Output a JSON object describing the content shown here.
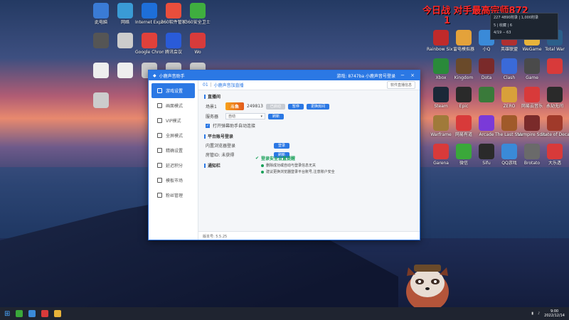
{
  "overlay": {
    "title": "今日战 对手最高宗师872",
    "number": "1"
  },
  "notification": {
    "line1": "227 4890附录 | 1,000附录",
    "line2": "5 | 收藏 | 6",
    "line3": "4/19 -- 63"
  },
  "desktop_left": [
    {
      "label": "此电脑",
      "color": "#3a7bd5"
    },
    {
      "label": "网络",
      "color": "#3a9bd5"
    },
    {
      "label": "Internet Explorer",
      "color": "#1e6fd9"
    },
    {
      "label": "360软件管家",
      "color": "#e94e3c"
    },
    {
      "label": "360安全卫士",
      "color": "#3fae3f"
    },
    {
      "label": "",
      "color": "#555"
    },
    {
      "label": "",
      "color": "#ccc"
    },
    {
      "label": "Google Chrome",
      "color": "#e0413b"
    },
    {
      "label": "腾讯会议",
      "color": "#2a5bd8"
    },
    {
      "label": "Wo",
      "color": "#d83b3b"
    },
    {
      "label": "",
      "color": "#eee"
    },
    {
      "label": "",
      "color": "#eee"
    },
    {
      "label": "",
      "color": "#ccc"
    },
    {
      "label": "",
      "color": "#ccc"
    },
    {
      "label": "",
      "color": "#ccc"
    },
    {
      "label": "",
      "color": "#ccc"
    }
  ],
  "desktop_right": [
    {
      "label": "Rainbow Six Siege",
      "color": "#c02a2a"
    },
    {
      "label": "雷电模拟器",
      "color": "#e4a23a"
    },
    {
      "label": "小Q",
      "color": "#3a8ad8"
    },
    {
      "label": "英雄联盟",
      "color": "#b03030"
    },
    {
      "label": "WeGame",
      "color": "#e8b33a"
    },
    {
      "label": "Total War",
      "color": "#2b5f8a"
    },
    {
      "label": "Xbox",
      "color": "#2a8a3a"
    },
    {
      "label": "Kingdom",
      "color": "#6a4a2a"
    },
    {
      "label": "Dota",
      "color": "#7a2a2a"
    },
    {
      "label": "Clash",
      "color": "#3a6ad8"
    },
    {
      "label": "Game",
      "color": "#4a4a4a"
    },
    {
      "label": "",
      "color": "#d83a3a"
    },
    {
      "label": "Steam",
      "color": "#1b2838"
    },
    {
      "label": "Epic",
      "color": "#2a2a2a"
    },
    {
      "label": "",
      "color": "#3a7a3a"
    },
    {
      "label": "ZERO",
      "color": "#d8a03a"
    },
    {
      "label": "网易云音乐",
      "color": "#d83a3a"
    },
    {
      "label": "永劫无间",
      "color": "#2a2a2a"
    },
    {
      "label": "Warframe",
      "color": "#a07a3a"
    },
    {
      "label": "网易有道",
      "color": "#d83a3a"
    },
    {
      "label": "Arcade",
      "color": "#7a3ad8"
    },
    {
      "label": "The Last Stand",
      "color": "#a05a2a"
    },
    {
      "label": "Vampire Survivors",
      "color": "#7a2a2a"
    },
    {
      "label": "State of Decay 2",
      "color": "#a03a2a"
    },
    {
      "label": "Garena",
      "color": "#d83a3a"
    },
    {
      "label": "微信",
      "color": "#3aa83a"
    },
    {
      "label": "Sifu",
      "color": "#2a2a2a"
    },
    {
      "label": "QQ游戏",
      "color": "#3a8ad8"
    },
    {
      "label": "Brotato",
      "color": "#6a6a6a"
    },
    {
      "label": "大乐透",
      "color": "#d83a3a"
    }
  ],
  "app": {
    "title": "小鹿声音助手",
    "right_title": "游戏: 8747ba 小鹿声音号登录",
    "sidebar": [
      {
        "label": "游戏设置",
        "active": true
      },
      {
        "label": "画面模式",
        "active": false
      },
      {
        "label": "VIP模式",
        "active": false
      },
      {
        "label": "全屏模式",
        "active": false
      },
      {
        "label": "精确设置",
        "active": false
      },
      {
        "label": "延迟积分",
        "active": false
      },
      {
        "label": "模板市场",
        "active": false
      },
      {
        "label": "粉丝管理",
        "active": false
      }
    ],
    "breadcrumb": {
      "home": "01",
      "current": "小鹿声音加直播",
      "right_button": "软件直播信息"
    },
    "live_section": "直播间",
    "room_label": "场景1",
    "room_number": "249813",
    "room_btn_disabled": "已启动",
    "room_btn1": "暂停",
    "room_btn2": "更换房间",
    "server_label": "服务器",
    "server_value": "自动",
    "refresh_btn": "刷新",
    "checkbox_label": "打开弹幕助手自动连接",
    "account_section": "平台账号登录",
    "account_row1_label": "内置浏览器登录",
    "account_row1_btn": "登录",
    "account_row2_label": "房管ID: 未获得",
    "account_row2_btn": "刷新",
    "status_ok": "登录安全设置提醒",
    "status_item1": "删除成功或自动与登录信息无关",
    "status_item2": "建议更换浏览器登录平台账号,注意账户安全",
    "notify_section": "通知栏",
    "footer": "版本号: 5.5.25"
  },
  "taskbar": {
    "time": "9:00",
    "date": "2022/12/14"
  }
}
